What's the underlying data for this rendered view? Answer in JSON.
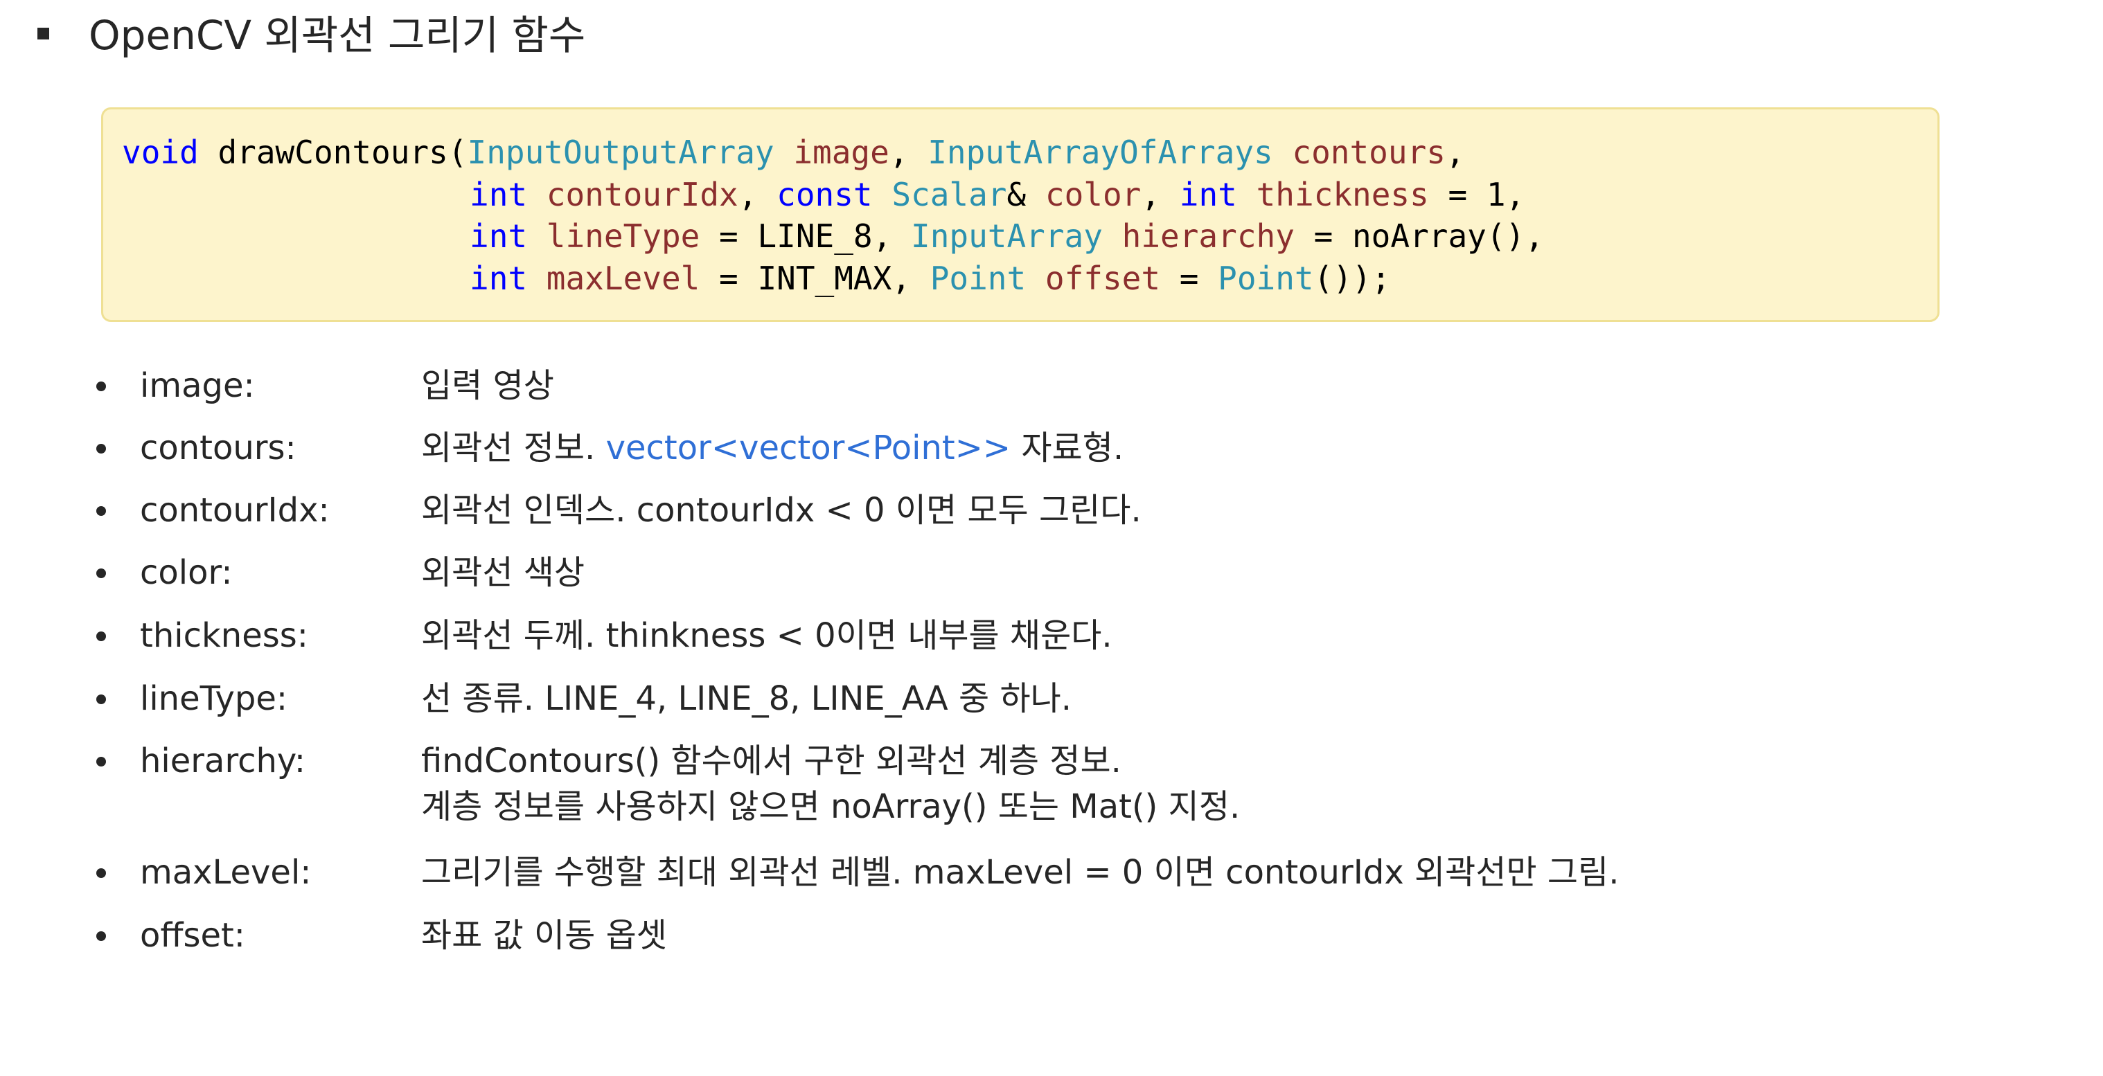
{
  "title": "OpenCV 외곽선 그리기 함수",
  "code": {
    "lines": [
      [
        {
          "t": "void",
          "k": "kw"
        },
        {
          "t": " drawContours(",
          "k": "plain"
        },
        {
          "t": "InputOutputArray",
          "k": "type"
        },
        {
          "t": " ",
          "k": "plain"
        },
        {
          "t": "image",
          "k": "id"
        },
        {
          "t": ", ",
          "k": "plain"
        },
        {
          "t": "InputArrayOfArrays",
          "k": "type"
        },
        {
          "t": " ",
          "k": "plain"
        },
        {
          "t": "contours",
          "k": "id"
        },
        {
          "t": ",",
          "k": "plain"
        }
      ],
      [
        {
          "t": "int",
          "k": "kw"
        },
        {
          "t": " ",
          "k": "plain"
        },
        {
          "t": "contourIdx",
          "k": "id"
        },
        {
          "t": ", ",
          "k": "plain"
        },
        {
          "t": "const",
          "k": "kw"
        },
        {
          "t": " ",
          "k": "plain"
        },
        {
          "t": "Scalar",
          "k": "type"
        },
        {
          "t": "& ",
          "k": "plain"
        },
        {
          "t": "color",
          "k": "id"
        },
        {
          "t": ", ",
          "k": "plain"
        },
        {
          "t": "int",
          "k": "kw"
        },
        {
          "t": " ",
          "k": "plain"
        },
        {
          "t": "thickness",
          "k": "id"
        },
        {
          "t": " = 1,",
          "k": "plain"
        }
      ],
      [
        {
          "t": "int",
          "k": "kw"
        },
        {
          "t": " ",
          "k": "plain"
        },
        {
          "t": "lineType",
          "k": "id"
        },
        {
          "t": " = LINE_8, ",
          "k": "plain"
        },
        {
          "t": "InputArray",
          "k": "type"
        },
        {
          "t": " ",
          "k": "plain"
        },
        {
          "t": "hierarchy",
          "k": "id"
        },
        {
          "t": " = noArray(),",
          "k": "plain"
        }
      ],
      [
        {
          "t": "int",
          "k": "kw"
        },
        {
          "t": " ",
          "k": "plain"
        },
        {
          "t": "maxLevel",
          "k": "id"
        },
        {
          "t": " = INT_MAX, ",
          "k": "plain"
        },
        {
          "t": "Point",
          "k": "type"
        },
        {
          "t": " ",
          "k": "plain"
        },
        {
          "t": "offset",
          "k": "id"
        },
        {
          "t": " = ",
          "k": "plain"
        },
        {
          "t": "Point",
          "k": "type"
        },
        {
          "t": "());",
          "k": "plain"
        }
      ]
    ]
  },
  "params": [
    {
      "name": "image:",
      "desc": "입력 영상"
    },
    {
      "name": "contours:",
      "desc_before": "외곽선 정보. ",
      "desc_accent": "vector<vector<Point>>",
      "desc_after": " 자료형."
    },
    {
      "name": "contourIdx:",
      "desc": "외곽선 인덱스. contourIdx < 0 이면 모두 그린다."
    },
    {
      "name": "color:",
      "desc": "외곽선 색상"
    },
    {
      "name": "thickness:",
      "desc": "외곽선 두께. thinkness < 0이면 내부를 채운다."
    },
    {
      "name": "lineType:",
      "desc": "선 종류. LINE_4, LINE_8, LINE_AA 중 하나."
    },
    {
      "name": "hierarchy:",
      "desc": "findContours() 함수에서 구한 외곽선 계층 정보.",
      "desc2": "계층 정보를 사용하지 않으면 noArray() 또는 Mat() 지정."
    },
    {
      "name": "maxLevel:",
      "desc": "그리기를 수행할 최대 외곽선 레벨. maxLevel = 0 이면 contourIdx 외곽선만 그림."
    },
    {
      "name": "offset:",
      "desc": "좌표 값 이동 옵셋"
    }
  ],
  "colors": {
    "code_bg": "#fdf4cc",
    "code_border": "#efe094",
    "keyword": "#0000ff",
    "type": "#2b91af",
    "identifier": "#8b2e2e",
    "accent_link": "#2f6fd6",
    "text": "#262626"
  }
}
